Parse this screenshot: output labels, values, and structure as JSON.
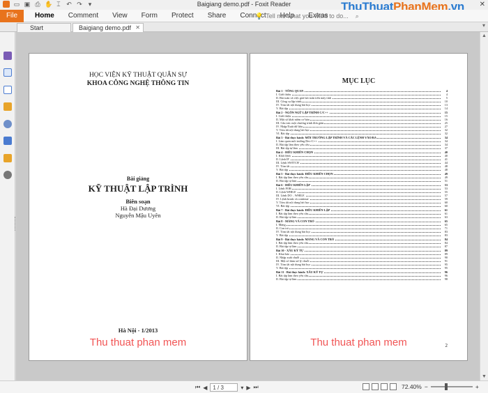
{
  "window": {
    "title": "Baigiang demo.pdf - Foxit Reader",
    "watermark_brand": {
      "part1": "ThuThuat",
      "part2": "PhanMem",
      "part3": ".vn"
    }
  },
  "menu": {
    "file": "File",
    "items": [
      "Home",
      "Comment",
      "View",
      "Form",
      "Protect",
      "Share",
      "Connect",
      "Help",
      "Extras"
    ],
    "search_placeholder": "Tell me what you want to do..."
  },
  "tabs": [
    {
      "label": "Start"
    },
    {
      "label": "Baigiang demo.pdf"
    }
  ],
  "page1": {
    "institute": "HỌC VIỆN KỸ THUẬT QUÂN SỰ",
    "faculty": "KHOA CÔNG NGHỆ THÔNG TIN",
    "lecture": "Bài giảng",
    "book_title": "KỸ THUẬT LẬP TRÌNH",
    "editors_label": "Biên soạn",
    "editor1": "Hà Đại Dương",
    "editor2": "Nguyễn Mậu Uyên",
    "date": "Hà Nội - 1/2013",
    "watermark": "Thu thuat phan mem"
  },
  "page2": {
    "toc_title": "MỤC LỤC",
    "page_number": "2",
    "watermark": "Thu thuat phan mem",
    "toc": [
      {
        "t": "Bài 1 - TỔNG QUAN",
        "p": "4",
        "ch": true
      },
      {
        "t": "I. Giới thiệu",
        "p": "4"
      },
      {
        "t": "II. Bài toán và việc giải bài toán trên máy tính",
        "p": "5"
      },
      {
        "t": "III. Công cụ lập trình",
        "p": "10"
      },
      {
        "t": "IV. Tóm tắt nội dung bài học",
        "p": "13"
      },
      {
        "t": "V. Bài tập",
        "p": "14"
      },
      {
        "t": "Bài 2 - NGÔN NGỮ LẬP TRÌNH C/C++",
        "p": "15",
        "ch": true
      },
      {
        "t": "I. Giới thiệu",
        "p": "15"
      },
      {
        "t": "II. Một số khái niệm cơ bản",
        "p": "16"
      },
      {
        "t": "III. Cấu trúc một chương trình đơn giản",
        "p": "25"
      },
      {
        "t": "IV. Nhập/Xuất dữ liệu",
        "p": "27"
      },
      {
        "t": "V. Tóm tắt nội dung bài học",
        "p": "32"
      },
      {
        "t": "VI. Bài tập",
        "p": "32"
      },
      {
        "t": "Bài 3 - Bài thực hành: MÔI TRƯỜNG LẬP TRÌNH VÀ CÁC LỆNH VÀO/RA",
        "p": "34",
        "ch": true
      },
      {
        "t": "I. Làm quen môi trường Dev-C++",
        "p": "34"
      },
      {
        "t": "II. Bài tập làm theo yêu cầu",
        "p": "34"
      },
      {
        "t": "III. Bài tập tự làm",
        "p": "37"
      },
      {
        "t": "Bài 4 - ĐIỀU KHIỂN CHỌN",
        "p": "40",
        "ch": true
      },
      {
        "t": "I. Khối lệnh",
        "p": "40"
      },
      {
        "t": "II. Lệnh IF",
        "p": "41"
      },
      {
        "t": "III. Lệnh SWITCH",
        "p": "44"
      },
      {
        "t": "IV. Tóm tắt",
        "p": "48"
      },
      {
        "t": "V. Bài tập",
        "p": "48"
      },
      {
        "t": "Bài 5 - Bài thực hành: ĐIỀU KHIỂN CHỌN",
        "p": "49",
        "ch": true
      },
      {
        "t": "I. Bài tập làm theo yêu cầu",
        "p": "49"
      },
      {
        "t": "II. Bài tập tự làm",
        "p": "51"
      },
      {
        "t": "Bài 6 - ĐIỀU KHIỂN LẶP",
        "p": "53",
        "ch": true
      },
      {
        "t": "I. Lệnh FOR",
        "p": "53"
      },
      {
        "t": "II. Lệnh WHILE",
        "p": "55"
      },
      {
        "t": "III. Lệnh DO .. WHILE",
        "p": "57"
      },
      {
        "t": "IV. Lệnh break và continue",
        "p": "59"
      },
      {
        "t": "V. Tóm tắt nội dung bài học",
        "p": "60"
      },
      {
        "t": "VI. Bài tập",
        "p": "60"
      },
      {
        "t": "Bài 7 - Bài thực hành: ĐIỀU KHIỂN LẶP",
        "p": "61",
        "ch": true
      },
      {
        "t": "I. Bài tập làm theo yêu cầu",
        "p": "61"
      },
      {
        "t": "II. Bài tập tự làm",
        "p": "63"
      },
      {
        "t": "Bài 8 - MẢNG VÀ CON TRỎ",
        "p": "65",
        "ch": true
      },
      {
        "t": "I. Mảng",
        "p": "65"
      },
      {
        "t": "II. Con trỏ",
        "p": "71"
      },
      {
        "t": "IV. Tóm tắt nội dung bài học",
        "p": "83"
      },
      {
        "t": "V. Bài tập",
        "p": "83"
      },
      {
        "t": "Bài 9 - Bài thực hành: MẢNG VÀ CON TRỎ",
        "p": "84",
        "ch": true
      },
      {
        "t": "I. Bài tập làm theo yêu cầu",
        "p": "84"
      },
      {
        "t": "II. Bài tập tự làm",
        "p": "87"
      },
      {
        "t": "Bài 10 - XÂU KÝ TỰ",
        "p": "89",
        "ch": true
      },
      {
        "t": "I. Khai báo",
        "p": "89"
      },
      {
        "t": "II. Nhập xuất chuỗi",
        "p": "90"
      },
      {
        "t": "III. Một số hàm xử lý chuỗi",
        "p": "91"
      },
      {
        "t": "IV. Tóm tắt nội dung bài học",
        "p": "95"
      },
      {
        "t": "V. Bài tập",
        "p": "95"
      },
      {
        "t": "Bài 11 - Bài thực hành: XÂU KÝ TỰ",
        "p": "96",
        "ch": true
      },
      {
        "t": "I. Bài tập làm theo yêu cầu",
        "p": "96"
      },
      {
        "t": "II. Bài tập tự làm",
        "p": "98"
      }
    ]
  },
  "status": {
    "page_box": "1 / 3",
    "zoom": "72.40%",
    "zoom_level_percent": 72.4
  },
  "colors": {
    "file_tab": "#e8731c",
    "watermark_red": "#ee2f2f"
  }
}
